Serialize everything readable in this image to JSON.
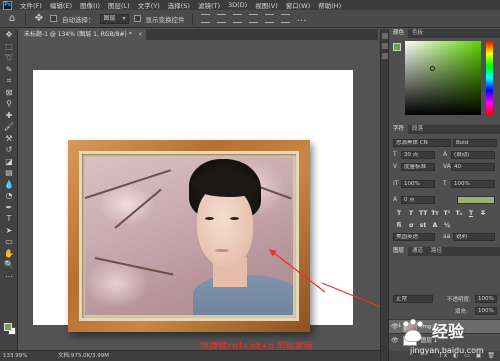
{
  "menubar": {
    "logo": "Ps",
    "items": [
      "文件(F)",
      "编辑(E)",
      "图像(I)",
      "图层(L)",
      "文字(Y)",
      "选择(S)",
      "滤镜(T)",
      "3D(D)",
      "视图(V)",
      "窗口(W)",
      "帮助(H)"
    ]
  },
  "options": {
    "auto_select_label": "自动选择：",
    "auto_select_value": "图层",
    "transform_label": "显示变换控件"
  },
  "document": {
    "tab_title": "未标题-1 @ 134% (图层 1, RGB/8#) *",
    "close_glyph": "×"
  },
  "canvas": {
    "annotation": "快捷键ctrl+alt+g 剪贴蒙版",
    "annotation_color": "#e8322b"
  },
  "status": {
    "zoom": "133.99%",
    "doc_size": "文档:975.0K/3.99M"
  },
  "panels": {
    "color_tabs": [
      "颜色",
      "色板"
    ],
    "character_tabs": [
      "字符",
      "段落"
    ],
    "layers_tabs": [
      "图层",
      "通道",
      "路径"
    ],
    "font_family": "思源黑体 CN",
    "font_style": "Bold",
    "font_size": "30 点",
    "leading": "(自动)",
    "kerning": "度量标准",
    "tracking": "40",
    "vscale": "100%",
    "hscale": "100%",
    "baseline": "0 点",
    "language": "美国英语",
    "aa": "锐利",
    "blend_mode": "正常",
    "opacity_label": "不透明度:",
    "opacity": "100%",
    "fill_label": "填充:",
    "fill": "100%",
    "layer_names": [
      "img (2)",
      "图层 1"
    ],
    "footer_glyphs": "fx ◐ ▭ ▣ 🗑"
  },
  "watermark": {
    "name": "Baidu 经验",
    "brand": "经验",
    "url": "jingyan.baidu.com"
  },
  "colors": {
    "accent": "#31a8ff",
    "fg_swatch": "#7aa05a",
    "frame_wood": "#b56f32"
  }
}
